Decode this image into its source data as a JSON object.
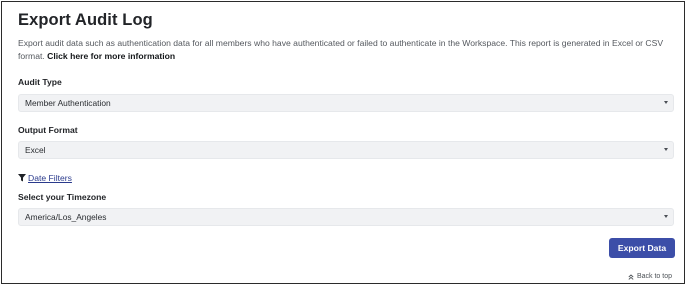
{
  "page": {
    "title": "Export Audit Log",
    "description": "Export audit data such as authentication data for all members who have authenticated or failed to authenticate in the Workspace. This report is generated in Excel or CSV format.",
    "more_info_link": "Click here for more information"
  },
  "audit_type": {
    "label": "Audit Type",
    "selected": "Member Authentication",
    "icon": "chevron-down-icon"
  },
  "output_format": {
    "label": "Output Format",
    "selected": "Excel",
    "icon": "chevron-down-icon"
  },
  "date_filters": {
    "label": "Date Filters",
    "icon": "filter-icon"
  },
  "timezone": {
    "label": "Select your Timezone",
    "selected": "America/Los_Angeles",
    "icon": "chevron-down-icon"
  },
  "actions": {
    "export_label": "Export Data",
    "export_color": "#3c4ea8"
  },
  "footer": {
    "back_to_top": "Back to top",
    "icon": "double-chevron-up-icon"
  }
}
